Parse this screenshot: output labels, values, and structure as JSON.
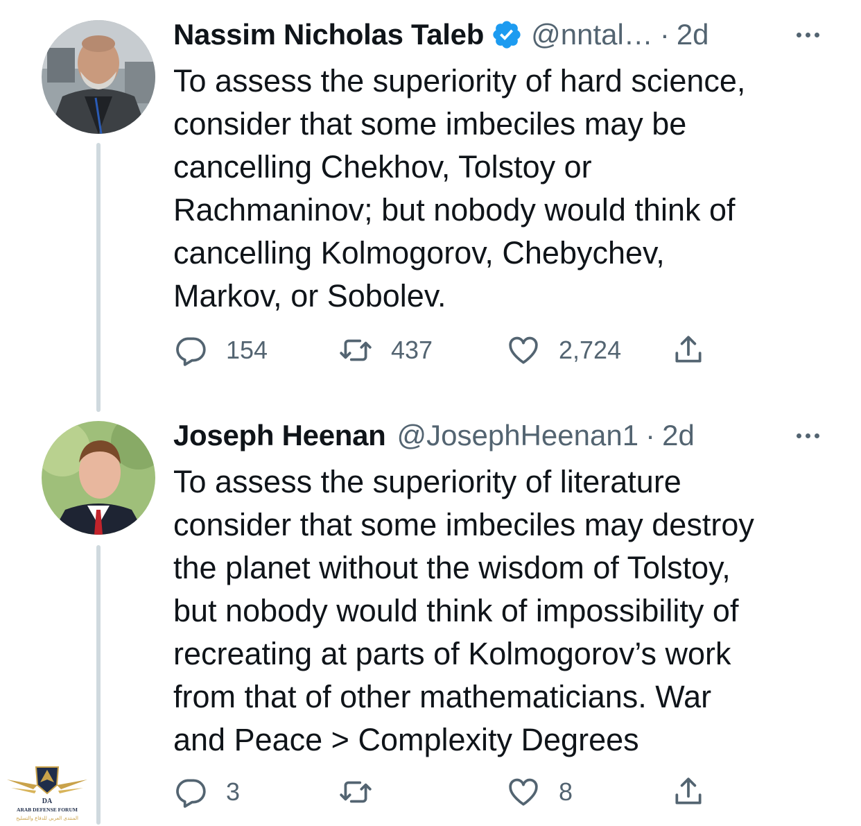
{
  "tweets": [
    {
      "display_name": "Nassim Nicholas Taleb",
      "verified": true,
      "handle": "@nntal…",
      "separator": "·",
      "time": "2d",
      "text": "To assess the superiority of hard science,\nconsider that some imbeciles may be\ncancelling Chekhov, Tolstoy or\nRachmaninov; but nobody would think of\ncancelling Kolmogorov, Chebychev,\nMarkov, or Sobolev.",
      "replies": "154",
      "retweets": "437",
      "likes": "2,724",
      "avatar_icon": "profile-photo-bearded-man"
    },
    {
      "display_name": "Joseph Heenan",
      "verified": false,
      "handle": "@JosephHeenan1",
      "separator": "·",
      "time": "2d",
      "text": "To assess the superiority of literature\nconsider that some imbeciles may destroy\nthe planet without the wisdom of Tolstoy,\nbut nobody would think of impossibility of\nrecreating at parts of Kolmogorov’s work\nfrom that of other mathematicians. War\nand Peace > Complexity Degrees",
      "replies": "3",
      "retweets": "",
      "likes": "8",
      "avatar_icon": "profile-photo-man-in-suit"
    }
  ],
  "icons": {
    "reply": "reply-icon",
    "retweet": "retweet-icon",
    "like": "heart-icon",
    "share": "share-icon",
    "more": "more-options-icon",
    "verified": "verified-badge-icon"
  },
  "watermark": {
    "logo_letters": "DA",
    "line1": "ARAB DEFENSE FORUM",
    "line2": "المنتدى العربي للدفاع والتسليح"
  },
  "colors": {
    "text": "#0f1419",
    "secondary": "#536471",
    "verified": "#1d9bf0",
    "thread_line": "#cfd9de"
  }
}
